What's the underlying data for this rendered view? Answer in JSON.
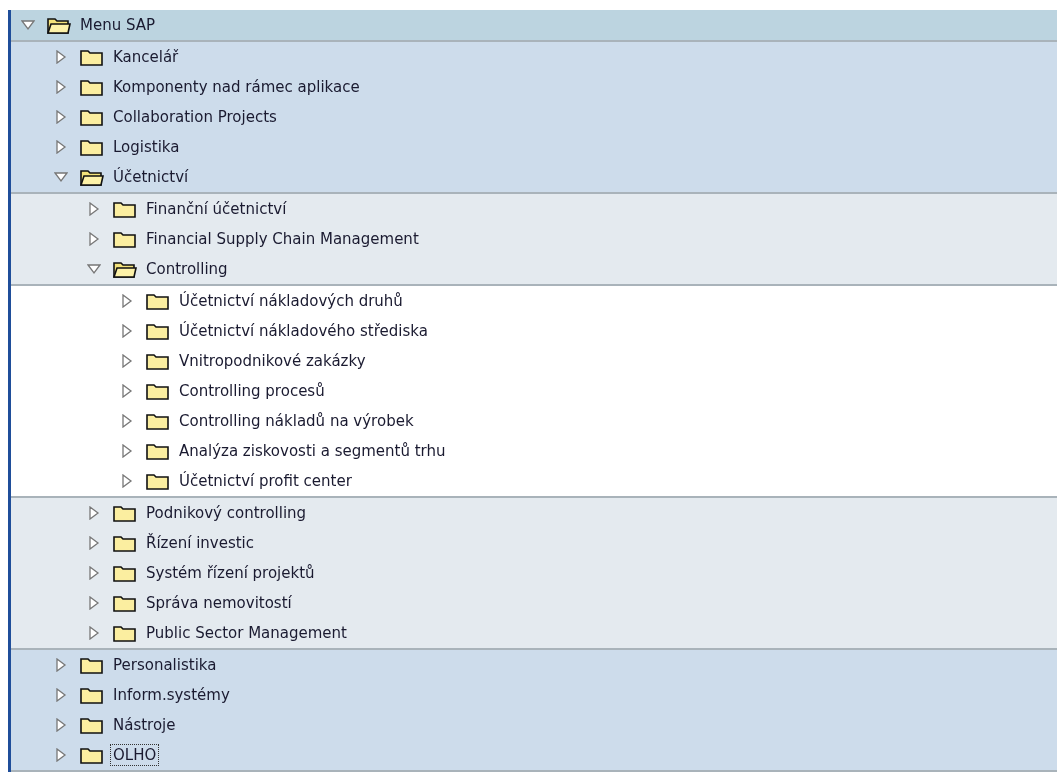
{
  "tree": {
    "label": "Menu SAP",
    "expanded": true,
    "focused": false,
    "children": [
      {
        "label": "Kancelář",
        "expanded": false,
        "focused": false
      },
      {
        "label": "Komponenty nad rámec aplikace",
        "expanded": false,
        "focused": false
      },
      {
        "label": "Collaboration Projects",
        "expanded": false,
        "focused": false
      },
      {
        "label": "Logistika",
        "expanded": false,
        "focused": false
      },
      {
        "label": "Účetnictví",
        "expanded": true,
        "focused": false,
        "children": [
          {
            "label": "Finanční účetnictví",
            "expanded": false,
            "focused": false
          },
          {
            "label": "Financial Supply Chain Management",
            "expanded": false,
            "focused": false
          },
          {
            "label": "Controlling",
            "expanded": true,
            "focused": false,
            "children": [
              {
                "label": "Účetnictví nákladových druhů",
                "expanded": false,
                "focused": false
              },
              {
                "label": "Účetnictví nákladového střediska",
                "expanded": false,
                "focused": false
              },
              {
                "label": "Vnitropodnikové zakázky",
                "expanded": false,
                "focused": false
              },
              {
                "label": "Controlling procesů",
                "expanded": false,
                "focused": false
              },
              {
                "label": "Controlling nákladů na výrobek",
                "expanded": false,
                "focused": false
              },
              {
                "label": "Analýza ziskovosti a segmentů trhu",
                "expanded": false,
                "focused": false
              },
              {
                "label": "Účetnictví profit center",
                "expanded": false,
                "focused": false
              }
            ]
          },
          {
            "label": "Podnikový controlling",
            "expanded": false,
            "focused": false
          },
          {
            "label": "Řízení investic",
            "expanded": false,
            "focused": false
          },
          {
            "label": "Systém řízení projektů",
            "expanded": false,
            "focused": false
          },
          {
            "label": "Správa nemovitostí",
            "expanded": false,
            "focused": false
          },
          {
            "label": "Public Sector Management",
            "expanded": false,
            "focused": false
          }
        ]
      },
      {
        "label": "Personalistika",
        "expanded": false,
        "focused": false
      },
      {
        "label": "Inform.systémy",
        "expanded": false,
        "focused": false
      },
      {
        "label": "Nástroje",
        "expanded": false,
        "focused": false
      },
      {
        "label": "OLHO",
        "expanded": false,
        "focused": true
      }
    ]
  }
}
